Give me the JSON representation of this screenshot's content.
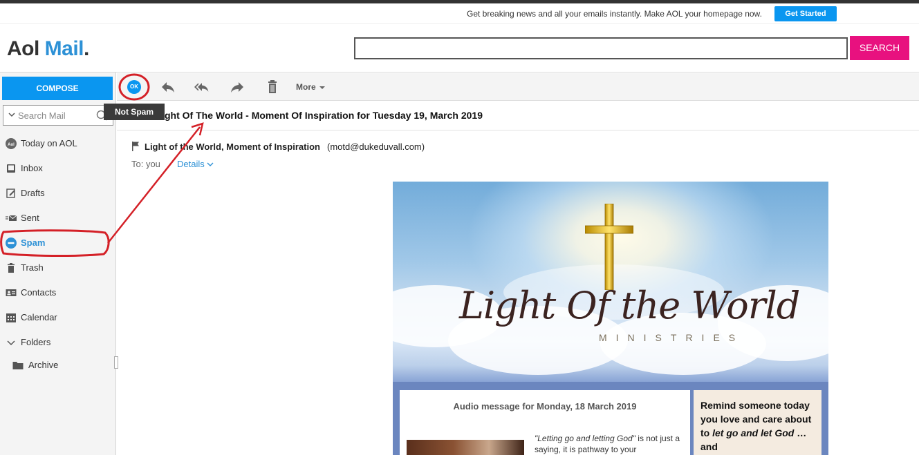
{
  "promo": {
    "text": "Get breaking news and all your emails instantly. Make AOL your homepage now.",
    "button": "Get Started"
  },
  "header": {
    "logo_aol": "Aol",
    "logo_mail": "Mail",
    "logo_dot": ".",
    "search_value": "",
    "search_button": "SEARCH"
  },
  "sidebar": {
    "compose": "COMPOSE",
    "search_placeholder": "Search Mail",
    "items": [
      {
        "label": "Today on AOL",
        "icon": "aol-icon"
      },
      {
        "label": "Inbox",
        "icon": "inbox-icon"
      },
      {
        "label": "Drafts",
        "icon": "drafts-icon"
      },
      {
        "label": "Sent",
        "icon": "sent-icon"
      },
      {
        "label": "Spam",
        "icon": "spam-icon",
        "active": true
      },
      {
        "label": "Trash",
        "icon": "trash-icon"
      },
      {
        "label": "Contacts",
        "icon": "contacts-icon"
      },
      {
        "label": "Calendar",
        "icon": "calendar-icon"
      },
      {
        "label": "Folders",
        "icon": "chevron-down-icon"
      },
      {
        "label": "Archive",
        "icon": "folder-icon"
      }
    ]
  },
  "toolbar": {
    "ok_label": "OK",
    "more": "More",
    "tooltip": "Not Spam"
  },
  "message": {
    "subject": "ght Of The World - Moment Of Inspiration for Tuesday 19, March 2019",
    "from_name": "Light of the World, Moment of Inspiration",
    "from_addr": "(motd@dukeduvall.com)",
    "to": "To: you",
    "details": "Details"
  },
  "email_body": {
    "brand_line1": "Light Of the World",
    "brand_line2": "MINISTRIES",
    "card_title": "Audio message for Monday, 18 March 2019",
    "quote_italic": "\"Letting go and letting God\"",
    "quote_rest": " is not just a saying, it is pathway to your",
    "side_1": "Remind someone today you love and care about to ",
    "side_italic": "let go and let God",
    "side_2": " … and"
  },
  "colors": {
    "accent_blue": "#0a96f0",
    "search_pink": "#e8117f",
    "annotation_red": "#d42027"
  }
}
